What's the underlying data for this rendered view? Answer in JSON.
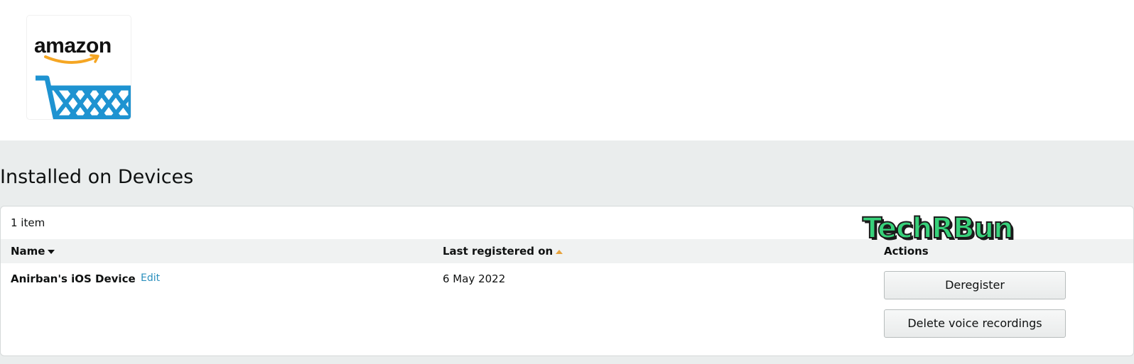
{
  "logo": {
    "word": "amazon"
  },
  "section": {
    "title": "Installed on Devices"
  },
  "list": {
    "count_label": "1 item",
    "columns": {
      "name": "Name",
      "last_registered": "Last registered on",
      "actions": "Actions"
    },
    "rows": [
      {
        "device_name": "Anirban's iOS Device",
        "edit_label": "Edit",
        "last_registered": "6 May 2022",
        "deregister_label": "Deregister",
        "delete_recordings_label": "Delete voice recordings"
      }
    ]
  },
  "watermark": {
    "text": "TechRBun"
  },
  "colors": {
    "band_bg": "#eaeded",
    "header_row_bg": "#f0f2f2",
    "link": "#2a8fbd",
    "sort_asc": "#e7a33e",
    "cart_blue": "#1e93d1",
    "smile_orange": "#f5a623",
    "watermark_green": "#37d17a"
  },
  "icons": {
    "logo": "amazon-cart-logo",
    "name_sort": "caret-down-icon",
    "date_sort": "caret-up-icon"
  }
}
